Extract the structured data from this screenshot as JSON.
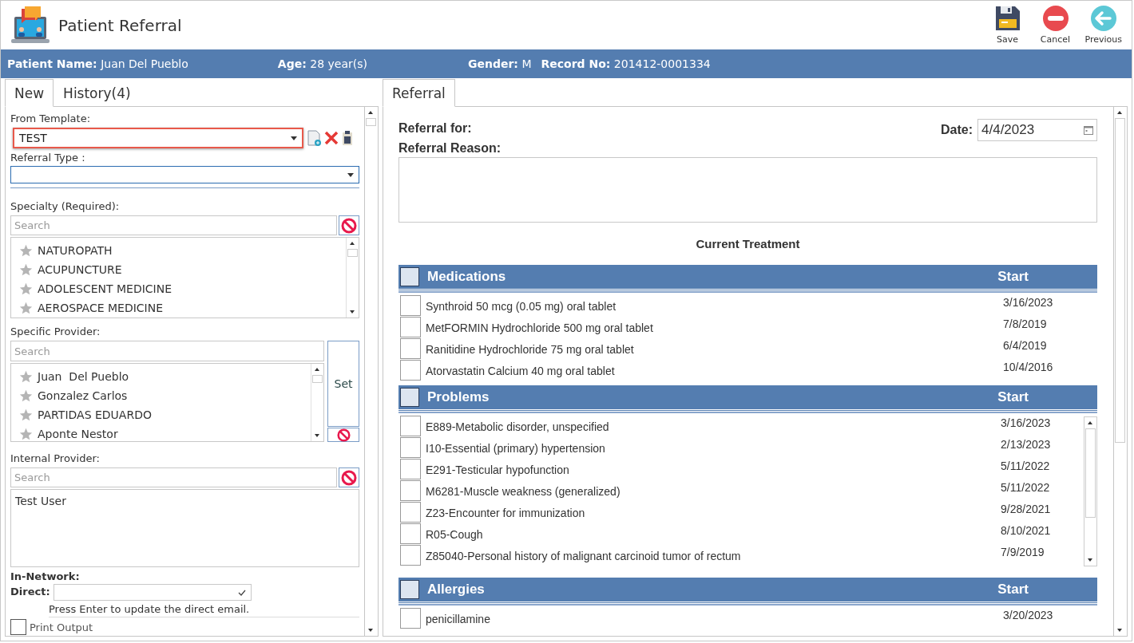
{
  "header": {
    "title": "Patient Referral",
    "actions": [
      {
        "kind": "save",
        "label": "Save"
      },
      {
        "kind": "cancel",
        "label": "Cancel"
      },
      {
        "kind": "previous",
        "label": "Previous"
      }
    ]
  },
  "patient_bar": [
    {
      "label": "Patient Name:",
      "value": "Juan Del Pueblo"
    },
    {
      "label": "Age:",
      "value": "28 year(s)"
    },
    {
      "label": "Gender:",
      "value": "M"
    },
    {
      "label": "Record No:",
      "value": "201412-0001334"
    }
  ],
  "left_tabs": [
    {
      "label": "New",
      "selected": true
    },
    {
      "label": "History",
      "count": "(4)",
      "selected": false
    }
  ],
  "form": {
    "template": {
      "label": "From Template:",
      "value": "TEST",
      "highlighted": true
    },
    "referral_type": {
      "label": "Referral Type :"
    },
    "specialty": {
      "label": "Specialty (Required):",
      "placeholder": "Search",
      "items": [
        "NATUROPATH",
        "ACUPUNCTURE",
        "ADOLESCENT MEDICINE",
        "AEROSPACE MEDICINE"
      ]
    },
    "provider": {
      "label": "Specific Provider:",
      "placeholder": "Search",
      "items": [
        "Juan  Del Pueblo",
        "Gonzalez Carlos",
        "PARTIDAS EDUARDO",
        "Aponte Nestor"
      ],
      "set_label": "Set"
    },
    "internal": {
      "label": "Internal Provider:",
      "placeholder": "Search",
      "items": [
        "Test User"
      ]
    },
    "in_network_label": "In-Network:",
    "direct": {
      "label": "Direct:",
      "hint": "Press Enter to update the direct email."
    },
    "print_output": {
      "label": "Print Output",
      "checked": false
    }
  },
  "right_tabs": [
    {
      "label": "Referral",
      "selected": true
    }
  ],
  "referral": {
    "for_label": "Referral for:",
    "reason_label": "Referral Reason:",
    "date_label": "Date:",
    "date_value": "4/4/2023",
    "treatment_title": "Current Treatment"
  },
  "sections": [
    {
      "title": "Medications",
      "start_label": "Start",
      "all_checked": false,
      "scroll": false,
      "rows": [
        {
          "text": "Synthroid 50 mcg (0.05 mg) oral tablet",
          "date": "3/16/2023",
          "checked": false
        },
        {
          "text": "MetFORMIN Hydrochloride 500 mg oral tablet",
          "date": "7/8/2019",
          "checked": false
        },
        {
          "text": "Ranitidine Hydrochloride 75 mg oral tablet",
          "date": "6/4/2019",
          "checked": false
        },
        {
          "text": "Atorvastatin Calcium 40 mg oral tablet",
          "date": "10/4/2016",
          "checked": false
        }
      ]
    },
    {
      "title": "Problems",
      "start_label": "Start",
      "all_checked": false,
      "scroll": true,
      "rows": [
        {
          "text": "E889-Metabolic disorder, unspecified",
          "date": "3/16/2023",
          "checked": false
        },
        {
          "text": "I10-Essential (primary) hypertension",
          "date": "2/13/2023",
          "checked": false
        },
        {
          "text": "E291-Testicular hypofunction",
          "date": "5/11/2022",
          "checked": false
        },
        {
          "text": "M6281-Muscle weakness (generalized)",
          "date": "5/11/2022",
          "checked": false
        },
        {
          "text": "Z23-Encounter for immunization",
          "date": "9/28/2021",
          "checked": false
        },
        {
          "text": "R05-Cough",
          "date": "8/10/2021",
          "checked": false
        },
        {
          "text": "Z85040-Personal history of malignant carcinoid tumor of rectum",
          "date": "7/9/2019",
          "checked": false
        }
      ]
    },
    {
      "title": "Allergies",
      "start_label": "Start",
      "all_checked": false,
      "scroll": false,
      "rows": [
        {
          "text": "penicillamine",
          "date": "3/20/2023",
          "checked": false
        }
      ]
    }
  ]
}
